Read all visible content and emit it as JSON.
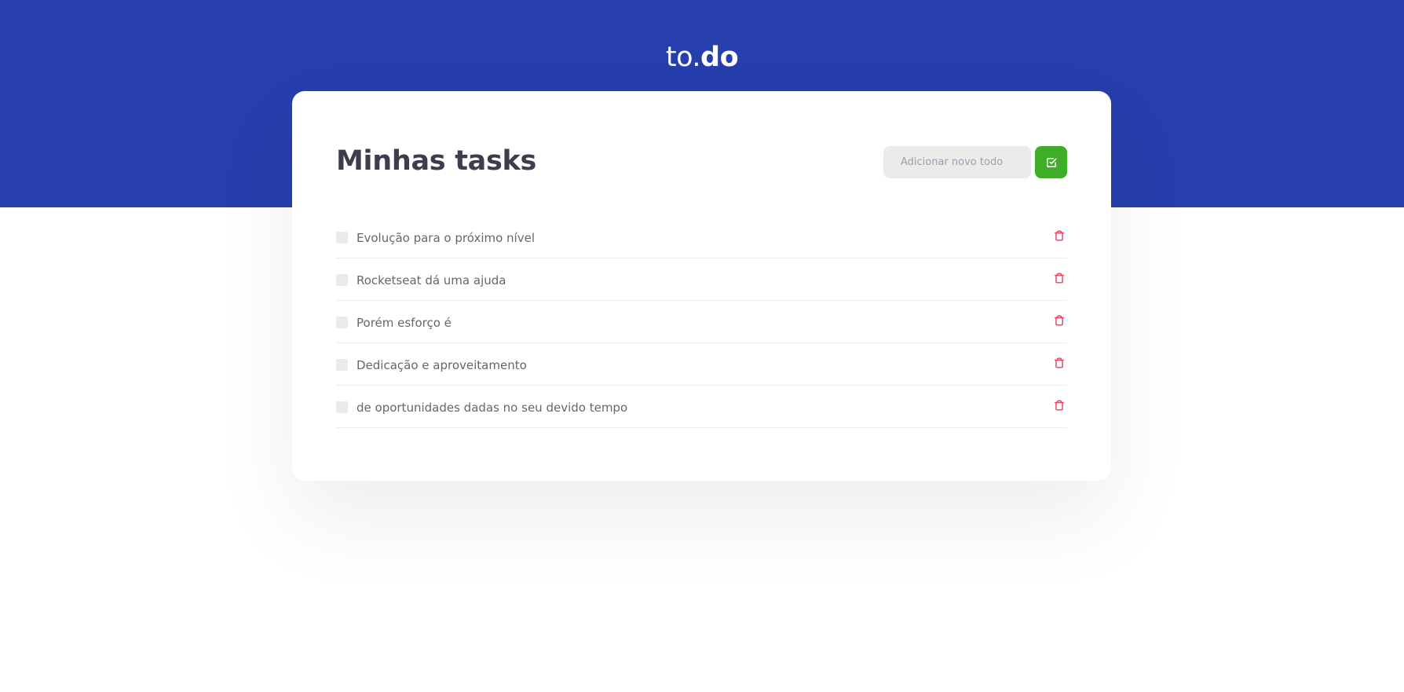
{
  "header": {
    "logo_light": "to.",
    "logo_bold": "do",
    "background_color": "#273fad"
  },
  "main": {
    "title": "Minhas tasks",
    "new_todo": {
      "placeholder": "Adicionar novo todo",
      "value": ""
    },
    "add_button": {
      "icon": "check-square-icon",
      "color": "#3fad27"
    },
    "tasks": [
      {
        "title": "Evolução para o próximo nível",
        "completed": false
      },
      {
        "title": "Rocketseat dá uma ajuda",
        "completed": false
      },
      {
        "title": "Porém esforço é",
        "completed": false
      },
      {
        "title": "Dedicação e aproveitamento",
        "completed": false
      },
      {
        "title": "de oportunidades dadas no seu devido tempo",
        "completed": false
      }
    ],
    "delete_icon": "trash-icon",
    "delete_color": "#e83f5b"
  }
}
